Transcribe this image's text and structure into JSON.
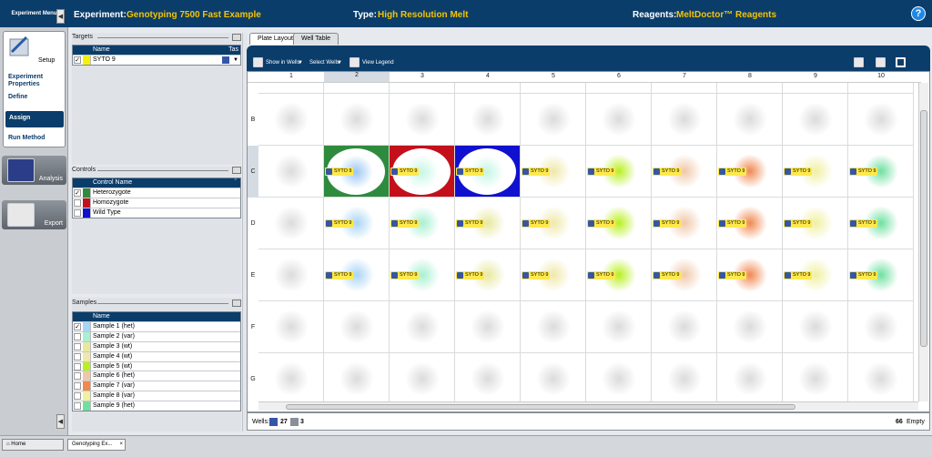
{
  "nav": {
    "header": "Experiment Menu",
    "setup": "Setup",
    "experiment_properties": "Experiment Properties",
    "define": "Define",
    "assign": "Assign",
    "run_method": "Run Method",
    "analysis": "Analysis",
    "export": "Export"
  },
  "header": {
    "experiment_label": "Experiment:",
    "experiment_value": "Genotyping 7500 Fast Example",
    "type_label": "Type:",
    "type_value": "High Resolution Melt",
    "reagents_label": "Reagents:",
    "reagents_value": "MeltDoctor™ Reagents",
    "help": "?"
  },
  "targets": {
    "title": "Targets",
    "col_name": "Name",
    "col_task": "Tas",
    "rows": [
      {
        "name": "SYTO 9",
        "checked": true,
        "color": "#f5f20a"
      }
    ]
  },
  "controls": {
    "title": "Controls",
    "col_name": "Control Name",
    "rows": [
      {
        "name": "Heterozygote",
        "checked": true,
        "color": "#2e8b3e"
      },
      {
        "name": "Homozygote",
        "checked": false,
        "color": "#c4101a"
      },
      {
        "name": "Wild Type",
        "checked": false,
        "color": "#1010d0"
      }
    ]
  },
  "samples": {
    "title": "Samples",
    "col_name": "Name",
    "rows": [
      {
        "name": "Sample 1 (het)",
        "checked": true,
        "color": "#a8d4f5"
      },
      {
        "name": "Sample 2 (var)",
        "checked": false,
        "color": "#a8f0d0"
      },
      {
        "name": "Sample 3 (wt)",
        "checked": false,
        "color": "#e8e8a0"
      },
      {
        "name": "Sample 4 (wt)",
        "checked": false,
        "color": "#f0e8a8"
      },
      {
        "name": "Sample 5 (wt)",
        "checked": false,
        "color": "#b8f020"
      },
      {
        "name": "Sample 6 (het)",
        "checked": false,
        "color": "#f0c8a8"
      },
      {
        "name": "Sample 7 (var)",
        "checked": false,
        "color": "#f08850"
      },
      {
        "name": "Sample 8 (var)",
        "checked": false,
        "color": "#f0f0a0"
      },
      {
        "name": "Sample 9 (het)",
        "checked": false,
        "color": "#70e0a0"
      }
    ]
  },
  "tabs": {
    "plate_layout": "Plate Layout",
    "well_table": "Well Table"
  },
  "toolbar": {
    "show_in_wells": "Show in Wells",
    "select_wells": "Select Wells",
    "view_legend": "View Legend"
  },
  "plate": {
    "columns": [
      "1",
      "2",
      "3",
      "4",
      "5",
      "6",
      "7",
      "8",
      "9",
      "10"
    ],
    "rows": [
      "",
      "B",
      "C",
      "D",
      "E",
      "F",
      "G"
    ],
    "well_label": "SYTO 9"
  },
  "footer": {
    "wells_label": "Wells:",
    "unknown_count": "27",
    "ntc_count": "3",
    "empty_count": "66",
    "empty_label": "Empty"
  },
  "taskbar": {
    "home": "Home",
    "tab": "Genotyping Ex...",
    "close": "×"
  }
}
